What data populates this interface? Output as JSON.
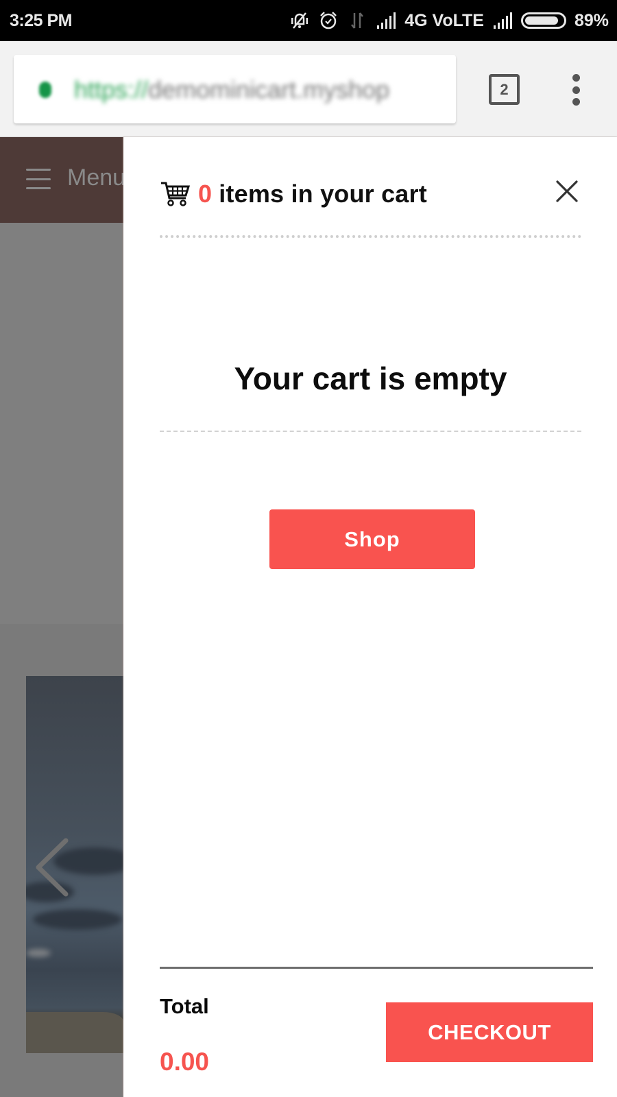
{
  "status_bar": {
    "time": "3:25 PM",
    "icons": [
      "vibrate-muted-icon",
      "alarm-icon",
      "data-transfer-icon",
      "signal-icon",
      "signal-icon-2",
      "battery-icon"
    ],
    "network": "4G VoLTE",
    "battery_percent": 89,
    "battery_label": "89%"
  },
  "browser": {
    "url_scheme": "https://",
    "url_host": "demominicart.myshop",
    "tab_count": "2"
  },
  "page_behind": {
    "menu_label": "Menu"
  },
  "cart": {
    "item_count": "0",
    "title_suffix": "items in your cart",
    "empty_message": "Your cart is empty",
    "shop_label": "Shop",
    "total_label": "Total",
    "total_value": "0.00",
    "checkout_label": "CHECKOUT",
    "accent_color": "#f9534f"
  }
}
